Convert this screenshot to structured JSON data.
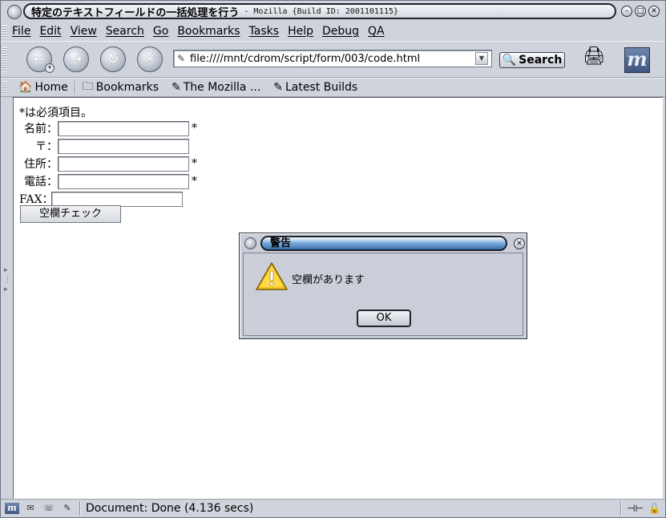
{
  "window": {
    "title": "特定のテキストフィールドの一括処理を行う",
    "subtitle": "- Mozilla {Build ID: 2001101115}"
  },
  "menu": [
    "File",
    "Edit",
    "View",
    "Search",
    "Go",
    "Bookmarks",
    "Tasks",
    "Help",
    "Debug",
    "QA"
  ],
  "navigation": {
    "url": "file:////mnt/cdrom/script/form/003/code.html",
    "search_label": "Search",
    "buttons": [
      "back-icon",
      "forward-icon",
      "reload-icon",
      "stop-icon"
    ]
  },
  "personal_toolbar": {
    "items": [
      "Home",
      "Bookmarks",
      "The Mozilla ...",
      "Latest Builds"
    ]
  },
  "form": {
    "note": "*は必須項目。",
    "fields": [
      {
        "label": "名前：",
        "value": "",
        "required": "*"
      },
      {
        "label": "〒：",
        "value": "",
        "required": ""
      },
      {
        "label": "住所：",
        "value": "",
        "required": "*"
      },
      {
        "label": "電話：",
        "value": "",
        "required": "*"
      },
      {
        "label": "FAX：",
        "value": "",
        "required": ""
      }
    ],
    "check_button": "空欄チェック"
  },
  "dialog": {
    "title": "警告",
    "message": "空欄があります",
    "ok_label": "OK",
    "icon": "warning-icon"
  },
  "status": {
    "text": "Document: Done (4.136 secs)"
  },
  "colors": {
    "chrome": "#cfd4dc",
    "dialog_title_blue": "#3a6ea8",
    "warning_yellow": "#f2c21a"
  }
}
